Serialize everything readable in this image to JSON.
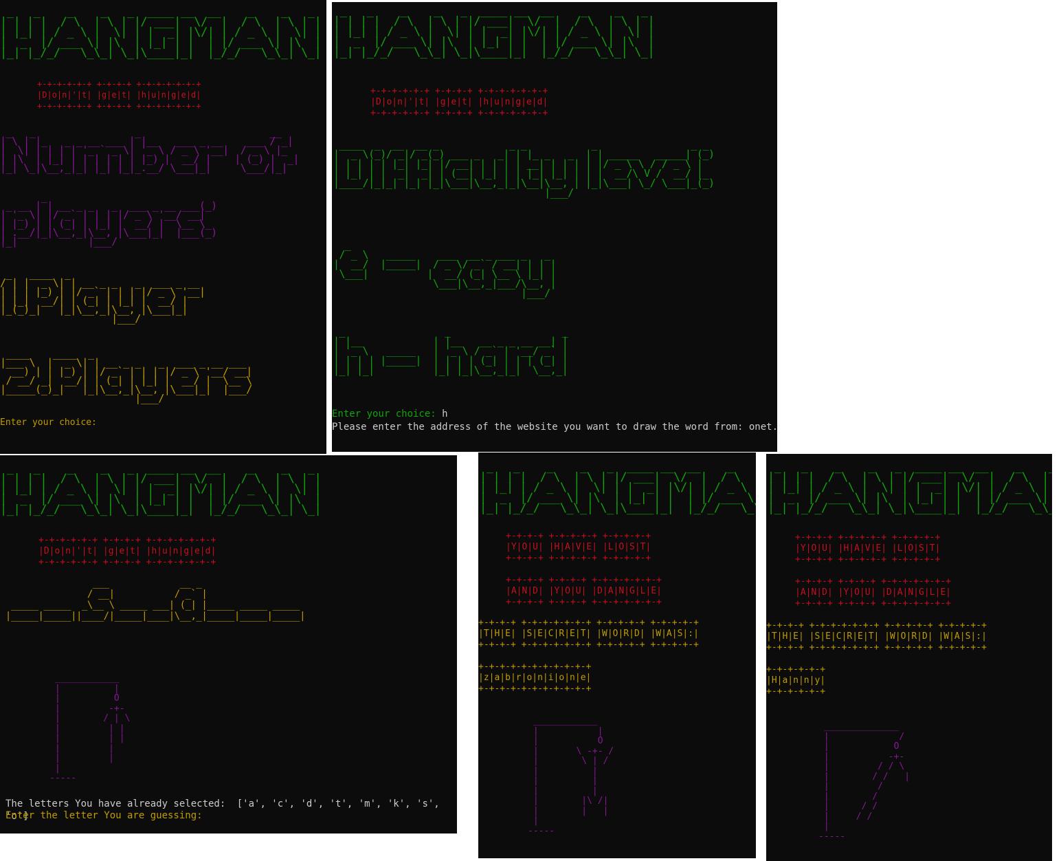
{
  "art": {
    "hangman": " _   _    _    _   _  ____ __  __    _    _   _ \n| | | |  / \\  | \\ | |/ ___|  \\/  |  / \\  | \\ | |\n| |_| | / _ \\ |  \\| | |  _| |\\/| | / _ \\ |  \\| |\n|  _  |/ ___ \\| |\\  | |_| | |  | |/ ___ \\| |\\  |\n|_| |_/_/   \\_\\_| \\_|\\____|_|  |_/_/   \\_\\_| \\_|",
    "dont_banner": "+-+-+-+-+-+ +-+-+-+ +-+-+-+-+-+-+\n|D|o|n|'|t| |g|e|t| |h|u|n|g|e|d|\n+-+-+-+-+-+ +-+-+-+ +-+-+-+-+-+-+",
    "you_have_lost": "+-+-+-+ +-+-+-+-+ +-+-+-+-+\n|Y|O|U| |H|A|V|E| |L|O|S|T|\n+-+-+-+ +-+-+-+-+ +-+-+-+-+",
    "and_you_dangle": "+-+-+-+ +-+-+-+ +-+-+-+-+-+-+\n|A|N|D| |Y|O|U| |D|A|N|G|L|E|\n+-+-+-+ +-+-+-+ +-+-+-+-+-+-+",
    "secret_word_was": "+-+-+-+ +-+-+-+-+-+-+ +-+-+-+-+ +-+-+-+-+\n|T|H|E| |S|E|C|R|E|T| |W|O|R|D| |W|A|S|:|\n+-+-+-+ +-+-+-+-+-+-+ +-+-+-+-+ +-+-+-+-+",
    "word_zabronione": "+-+-+-+-+-+-+-+-+-+-+\n|z|a|b|r|o|n|i|o|n|e|\n+-+-+-+-+-+-+-+-+-+-+",
    "word_hanny": "+-+-+-+-+-+\n|H|a|n|n|y|\n+-+-+-+-+-+",
    "number_of": " _   _                 _                      __ \n| \\ | |_   _ _ __ ___ | |__   ___ _ __    ___ / _|\n|  \\| | | | | '_ ` _ \\| '_ \\ / _ \\ '__|  / _ \\ |_ \n| |\\  | |_| | | | | | | |_) |  __/ |    | (_) |  _|\n|_| \\_|\\__,_|_| |_| |_|_.__/ \\___|_|     \\___/|_|  ",
    "players_colon": "       _                           \n _ __ | | __ _ _   _  ___ _ __ ___(_)\n| '_ \\| |/ _` | | | |/ _ \\ '__/ __|  \n| |_) | | (_| | |_| |  __/ |  \\__ \\_ \n| .__/|_|\\__,_|\\__, |\\___|_|  |___(_)\n|_|            |___/                 ",
    "one_player": " _   ____  _                       \n/ | |  _ \\| | __ _ _   _  ___ _ __ \n| | | |_) | |/ _` | | | |/ _ \\ '__|\n| |_|  __/| | (_| | |_| |  __/ |   \n|_(_)_|   |_|\\__,_|\\__, |\\___|_|   \n                   |___/           ",
    "two_players": " ____    ____  _                           \n|___ \\  |  _ \\| | __ _ _   _  ___ _ __ ___ \n  __) | | |_) | |/ _` | | | |/ _ \\ '__/ __|\n / __/ _|  __/| | (_| | |_| |  __/ |  \\__ \\\n|_____(_)_|   |_|\\__,_|\\__, |\\___|_|  |___/\n                       |___/               ",
    "difficulty_level": " ____  _  __  __ _            _ _           _                _ _ \n|  _ \\(_)/ _|/ _(_) ___ _   _| | |_ _   _  | | _____   _____| (_)\n| | | | | |_| |_| |/ __| | | | | __| | | | | |/ _ \\ \\ / / _ \\ |  \n| |_| | |  _|  _| | (__| |_| | | |_| |_| | | |  __/\\ V /  __/ |_ \n|____/|_|_| |_| |_|\\___|\\__,_|_|\\__|\\__, | |_|\\___| \\_/ \\___|_(_)\n                                    |___/                        ",
    "e_easy": "  _                                    \n / _ \\   _____    ___  __ _ ___ _   _ \n|  __/  |_____|  / _ \\/ _` / __| | | |\n \\___|          |  __/ (_| \\__ \\ |_| |\n                 \\___|\\__,_|___/\\__, |\n                                |___/ ",
    "h_hard": " _                 _                   _ \n| |__            | |__   __ _ _ __ __| |\n| '_ \\   _____   | '_ \\ / _` | '__/ _` |\n| | | | |_____|  | | | | (_| | | | (_| |\n|_| |_|          |_| |_|\\__,_|_|  \\__,_|",
    "word_progress": "                 ___             __ _ \n                / __|           / _` |\n  _____ _____  _\\__ \\ _____ ___| (_| |_____ _____ _____\n |_____|_____||____/|_____|____|\\__,_|_____|_____|_____|",
    "gallows_1": " ____________\n |          |\n |          O\n |         -+-\n |        / | \\\n |         | |\n |         | |\n |         |\n |         |\n |\n-----",
    "gallows_2": " ____________\n |           |\n |           O\n |       \\ -+- /\n |        \\ | /\n |          |\n |          |\n |          |\n |        |\\ /|\n |        |   |\n |\n-----",
    "gallows_3": " ______________\n |             /\n |            O\n |           -+-\n |         / / \\\n |        / /   |\n |         /\n |        /\n |      / /\n |     / /\n |\n-----"
  },
  "screens": {
    "players": {
      "prompt": "Enter your choice:"
    },
    "difficulty": {
      "prompt": "Enter your choice:",
      "choice": "h",
      "website_prompt": "Please enter the address of the website you want to draw the word from: onet.pl"
    },
    "guessing": {
      "selected_label": "The letters You have already selected:",
      "selected_letters": "['a', 'c', 'd', 't', 'm', 'k', 's', 'o']",
      "guess_prompt": "Enter the letter You are guessing:"
    }
  },
  "colors": {
    "background": "#0c0c0c",
    "green": "#13a10e",
    "red": "#c50f1f",
    "purple": "#881798",
    "orange": "#c19c00",
    "white": "#cccccc"
  }
}
